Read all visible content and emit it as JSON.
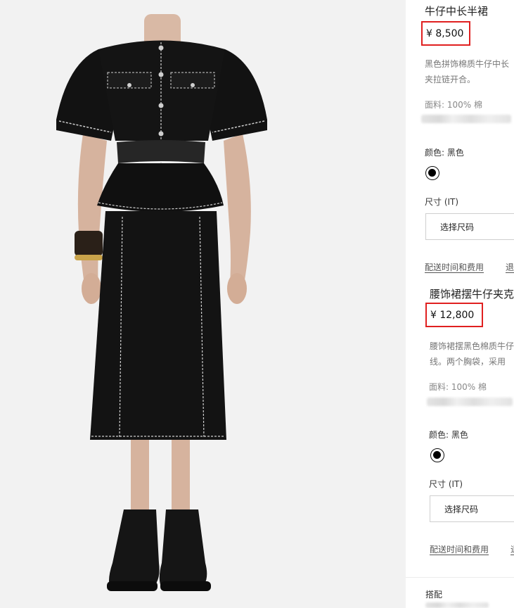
{
  "product_image": {
    "alt_subject": "model-wearing-black-denim-dress"
  },
  "products": [
    {
      "title": "牛仔中长半裙",
      "price": "¥ 8,500",
      "description_lines": [
        "黑色拼饰棉质牛仔中长",
        "夹拉链开合。"
      ],
      "fabric": "面料: 100% 棉",
      "color_label": "颜色: 黑色",
      "size_label": "尺寸  (IT)",
      "size_select": "选择尺码",
      "shipping_link": "配送时间和费用",
      "returns_link": "退"
    },
    {
      "title": "腰饰裙摆牛仔夹克",
      "price": "¥ 12,800",
      "description_lines": [
        "腰饰裙摆黑色棉质牛仔",
        "线。两个胸袋，采用"
      ],
      "fabric": "面料: 100% 棉",
      "color_label": "颜色: 黑色",
      "size_label": "尺寸  (IT)",
      "size_select": "选择尺码",
      "shipping_link": "配送时间和费用",
      "returns_link": "退"
    }
  ],
  "pairing_label": "搭配",
  "colors": {
    "price_highlight": "#e02020",
    "swatch": "#000000"
  }
}
